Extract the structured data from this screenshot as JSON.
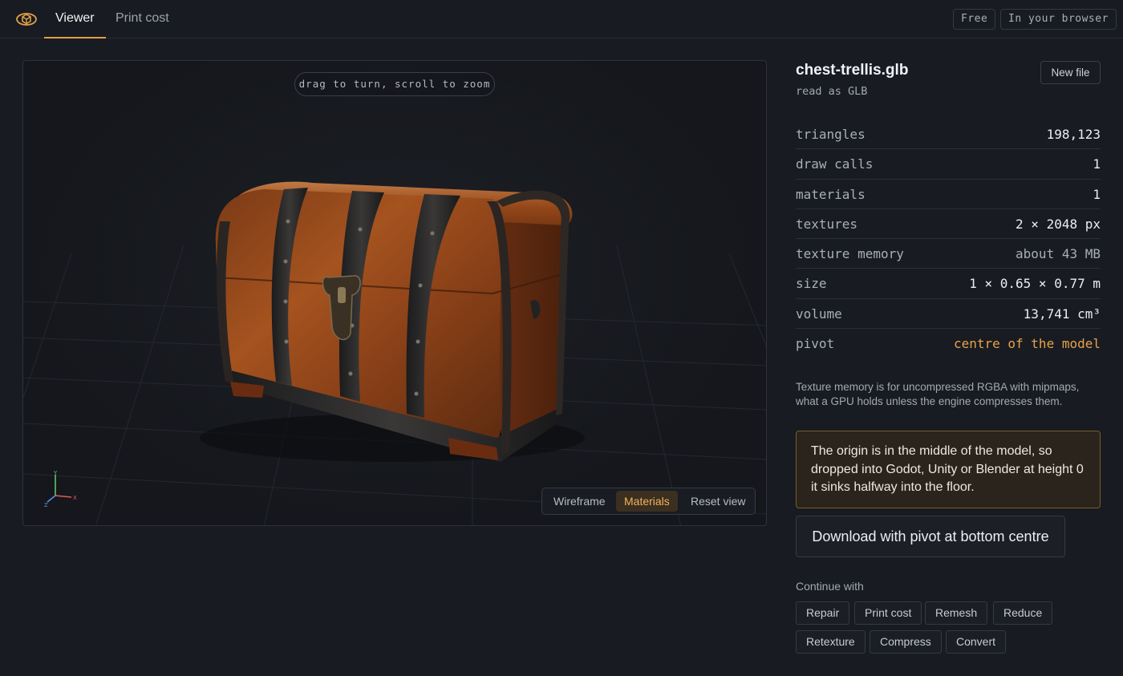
{
  "topbar": {
    "tabs": [
      {
        "label": "Viewer",
        "active": true
      },
      {
        "label": "Print cost",
        "active": false
      }
    ],
    "badges": [
      "Free",
      "In your browser"
    ],
    "accent_color": "#e0a047"
  },
  "viewer": {
    "hint": "drag to turn, scroll to zoom",
    "controls": {
      "wireframe": "Wireframe",
      "materials": "Materials",
      "reset": "Reset view",
      "active": "Materials"
    },
    "axes": {
      "x": "X",
      "y": "Y",
      "z": "Z"
    }
  },
  "file": {
    "name": "chest-trellis.glb",
    "read_as": "read as GLB",
    "new_file": "New file"
  },
  "stats": [
    {
      "label": "triangles",
      "value": "198,123"
    },
    {
      "label": "draw calls",
      "value": "1"
    },
    {
      "label": "materials",
      "value": "1"
    },
    {
      "label": "textures",
      "value": "2 × 2048 px"
    },
    {
      "label": "texture memory",
      "value": "about 43 MB"
    },
    {
      "label": "size",
      "value": "1 × 0.65 × 0.77 m"
    },
    {
      "label": "volume",
      "value": "13,741 cm³"
    },
    {
      "label": "pivot",
      "value": "centre of the model"
    }
  ],
  "note": "Texture memory is for uncompressed RGBA with mipmaps, what a GPU holds unless the engine compresses them.",
  "warning": "The origin is in the middle of the model, so dropped into Godot, Unity or Blender at height 0 it sinks halfway into the floor.",
  "download": "Download with pivot at bottom centre",
  "continue": {
    "label": "Continue with",
    "actions": [
      "Repair",
      "Print cost",
      "Remesh",
      "Reduce",
      "Retexture",
      "Compress",
      "Convert"
    ]
  }
}
